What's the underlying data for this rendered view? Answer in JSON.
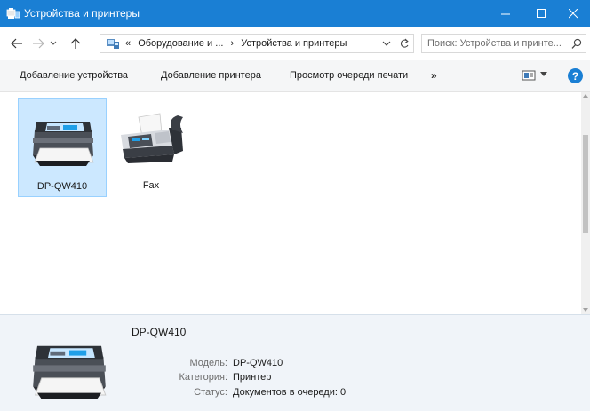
{
  "window": {
    "title": "Устройства и принтеры",
    "controls": {
      "minimize": "—",
      "maximize": "☐",
      "close": "✕"
    }
  },
  "address": {
    "crumbs": [
      "«",
      "Оборудование и ...",
      "›",
      "Устройства и принтеры"
    ],
    "search_placeholder": "Поиск: Устройства и принте..."
  },
  "commands": {
    "add_device": "Добавление устройства",
    "add_printer": "Добавление принтера",
    "print_queue": "Просмотр очереди печати",
    "more": "»",
    "help": "?"
  },
  "devices": [
    {
      "name": "DP-QW410",
      "icon": "printer-icon",
      "selected": true
    },
    {
      "name": "Fax",
      "icon": "fax-icon",
      "selected": false
    }
  ],
  "details": {
    "title": "DP-QW410",
    "model_label": "Модель:",
    "model_value": "DP-QW410",
    "category_label": "Категория:",
    "category_value": "Принтер",
    "status_label": "Статус:",
    "status_value": "Документов в очереди: 0"
  },
  "colors": {
    "titlebar": "#1a7fd4",
    "selection": "#cce8ff",
    "details_bg": "#f0f4f9"
  }
}
